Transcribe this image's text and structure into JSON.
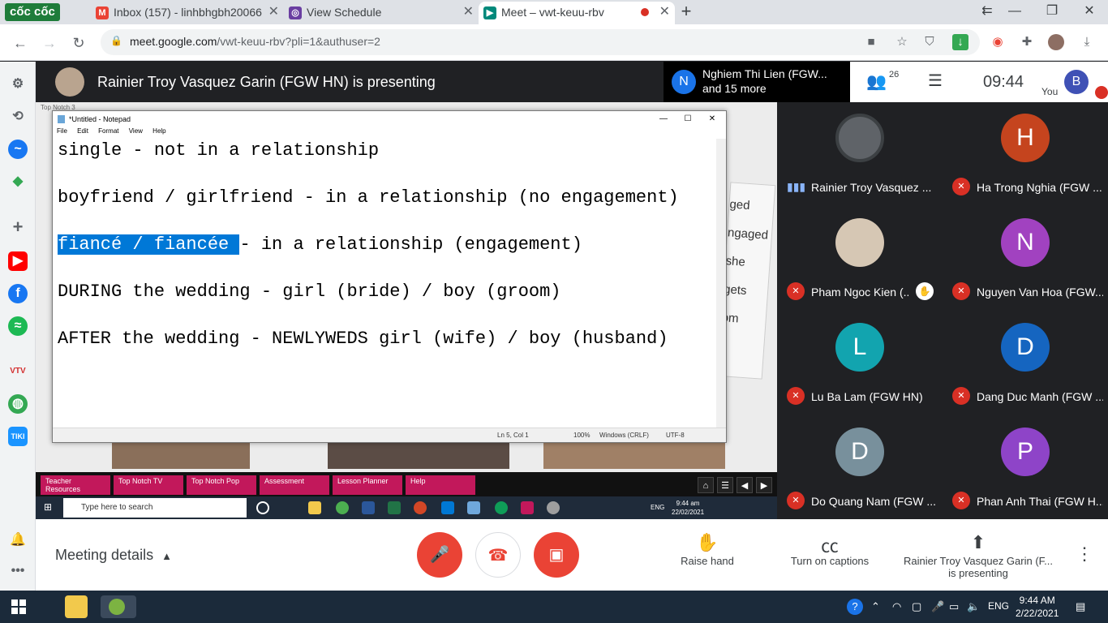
{
  "browser": {
    "logo": "cốc cốc",
    "tabs": [
      {
        "label": "Inbox (157) - linhbhgbh20066",
        "icon": "gmail-icon"
      },
      {
        "label": "View Schedule",
        "icon": "schedule-icon"
      },
      {
        "label": "Meet – vwt-keuu-rbv",
        "icon": "meet-icon"
      }
    ],
    "url_host": "meet.google.com",
    "url_path": "/vwt-keuu-rbv?pli=1&authuser=2"
  },
  "meet": {
    "presenter_banner": "Rainier Troy Vasquez Garin (FGW HN) is presenting",
    "joined": {
      "initial": "N",
      "line1": "Nghiem Thi Lien (FGW...",
      "line2": "and 15 more"
    },
    "people_count": "26",
    "time": "09:44",
    "self_label": "You",
    "self_initial": "B",
    "participants": [
      {
        "name": "Rainier Troy Vasquez ...",
        "initial": "",
        "color": "#5f6368",
        "status": "speaking"
      },
      {
        "name": "Ha Trong Nghia (FGW ...",
        "initial": "H",
        "color": "#c5441e",
        "status": "muted"
      },
      {
        "name": "Pham Ngoc Kien (...",
        "initial": "",
        "color": "#d6c7b4",
        "status": "muted",
        "hand_raised": true
      },
      {
        "name": "Nguyen Van Hoa (FGW...",
        "initial": "N",
        "color": "#a142c0",
        "status": "muted"
      },
      {
        "name": "Lu Ba Lam (FGW HN)",
        "initial": "L",
        "color": "#12a4af",
        "status": "muted"
      },
      {
        "name": "Dang Duc Manh (FGW ...",
        "initial": "D",
        "color": "#1565c0",
        "status": "muted"
      },
      {
        "name": "Do Quang Nam (FGW ...",
        "initial": "D",
        "color": "#78909c",
        "status": "muted"
      },
      {
        "name": "Phan Anh Thai (FGW H...",
        "initial": "P",
        "color": "#8e44c8",
        "status": "muted"
      }
    ],
    "controls": {
      "meeting_details": "Meeting details",
      "raise_hand": "Raise hand",
      "captions": "Turn on captions",
      "presenting_line1": "Rainier Troy Vasquez Garin (F...",
      "presenting_line2": "is presenting"
    }
  },
  "shared": {
    "app_title": "Top Notch 3",
    "notepad": {
      "title": "*Untitled - Notepad",
      "menu": [
        "File",
        "Edit",
        "Format",
        "View",
        "Help"
      ],
      "lines": [
        "single - not in a relationship",
        "boyfriend / girlfriend - in a relationship (no engagement)",
        "- in a relationship (engagement)",
        "DURING the wedding - girl (bride) / boy (groom)",
        "AFTER the wedding - NEWLYWEDS girl (wife) / boy (husband)"
      ],
      "selected_text": "fiancé / fiancée ",
      "status": {
        "position": "Ln 5, Col 1",
        "zoom": "100%",
        "eol": "Windows (CRLF)",
        "encoding": "UTF-8"
      }
    },
    "slide_card_words": [
      "ged",
      "ngaged",
      "she",
      "gets",
      "om"
    ],
    "nav_buttons": [
      "Teacher Resources",
      "Top Notch TV",
      "Top Notch Pop",
      "Assessment",
      "Lesson Planner",
      "Help"
    ],
    "taskbar_search": "Type here to search",
    "taskbar_lang": "ENG",
    "taskbar_time": "9:44 am",
    "taskbar_date": "22/02/2021"
  },
  "os": {
    "lang": "ENG",
    "time": "9:44 AM",
    "date": "2/22/2021"
  }
}
